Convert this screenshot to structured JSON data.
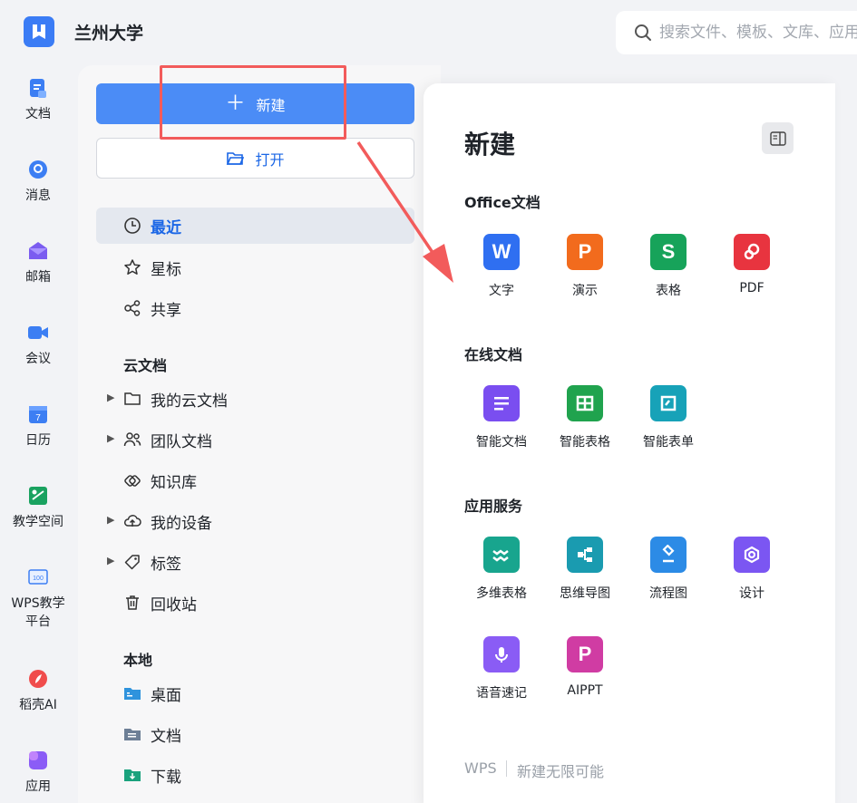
{
  "header": {
    "org_name": "兰州大学",
    "search_placeholder": "搜索文件、模板、文库、应用"
  },
  "rail": {
    "items": [
      {
        "label": "文档",
        "icon": "doc-icon"
      },
      {
        "label": "消息",
        "icon": "message-icon"
      },
      {
        "label": "邮箱",
        "icon": "mail-icon"
      },
      {
        "label": "会议",
        "icon": "meeting-icon"
      },
      {
        "label": "日历",
        "icon": "calendar-icon"
      },
      {
        "label": "教学空间",
        "icon": "teaching-space-icon"
      },
      {
        "label": "WPS教学\n平台",
        "icon": "wps-teaching-icon"
      },
      {
        "label": "稻壳AI",
        "icon": "docer-ai-icon"
      },
      {
        "label": "应用",
        "icon": "apps-icon"
      }
    ]
  },
  "sidebar": {
    "new_label": "新建",
    "open_label": "打开",
    "nav": [
      {
        "label": "最近",
        "icon": "clock-icon"
      },
      {
        "label": "星标",
        "icon": "star-icon"
      },
      {
        "label": "共享",
        "icon": "share-icon"
      }
    ],
    "cloud_title": "云文档",
    "cloud": [
      {
        "label": "我的云文档",
        "icon": "folder-icon"
      },
      {
        "label": "团队文档",
        "icon": "team-icon"
      },
      {
        "label": "知识库",
        "icon": "knowledge-icon"
      },
      {
        "label": "我的设备",
        "icon": "cloud-device-icon"
      },
      {
        "label": "标签",
        "icon": "tag-icon"
      },
      {
        "label": "回收站",
        "icon": "trash-icon"
      }
    ],
    "local_title": "本地",
    "local": [
      {
        "label": "桌面",
        "icon": "desktop-folder-icon"
      },
      {
        "label": "文档",
        "icon": "documents-folder-icon"
      },
      {
        "label": "下载",
        "icon": "download-folder-icon"
      }
    ]
  },
  "new_panel": {
    "title": "新建",
    "office_title": "Office文档",
    "office": [
      {
        "label": "文字",
        "glyph": "W",
        "color": "#2f6ff1"
      },
      {
        "label": "演示",
        "glyph": "P",
        "color": "#f26b1d"
      },
      {
        "label": "表格",
        "glyph": "S",
        "color": "#17a35a"
      },
      {
        "label": "PDF",
        "glyph": "",
        "color": "#e8343f"
      }
    ],
    "online_title": "在线文档",
    "online": [
      {
        "label": "智能文档",
        "color": "#7a4ef0"
      },
      {
        "label": "智能表格",
        "color": "#20a34e"
      },
      {
        "label": "智能表单",
        "color": "#17a2b8"
      }
    ],
    "services_title": "应用服务",
    "services": [
      {
        "label": "多维表格",
        "color": "#18a58e"
      },
      {
        "label": "思维导图",
        "color": "#1a9bb0"
      },
      {
        "label": "流程图",
        "color": "#2c8be6"
      },
      {
        "label": "设计",
        "color": "#7b56f2"
      },
      {
        "label": "语音速记",
        "color": "#8a5cf5"
      },
      {
        "label": "AIPPT",
        "glyph": "P",
        "color": "#d03ca3"
      }
    ],
    "footer_brand": "WPS",
    "footer_slogan": "新建无限可能"
  },
  "colors": {
    "accent": "#4b8cf6",
    "annotation": "#f25b5b"
  }
}
